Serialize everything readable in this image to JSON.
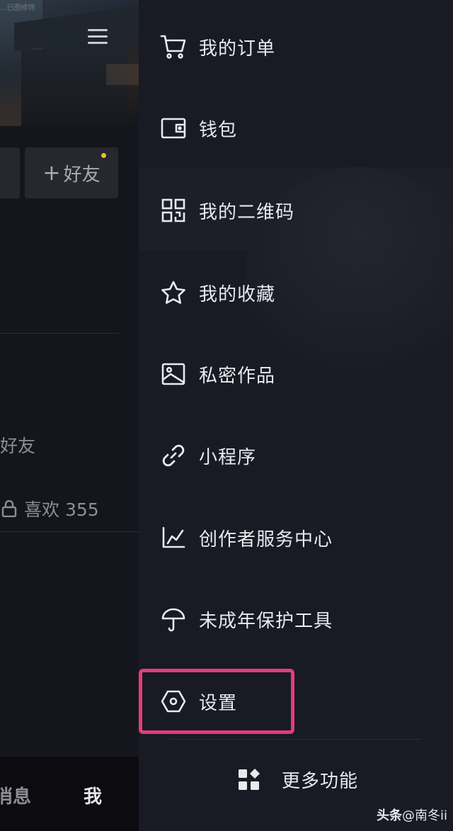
{
  "left_panel": {
    "banner_caption": "...已图修饰",
    "add_friend_label": "好友",
    "add_friend_plus": "+",
    "friends_text": "好友",
    "likes_label": "喜欢 355",
    "tab_messages": "消息",
    "tab_me": "我"
  },
  "drawer": {
    "items": [
      {
        "label": "我的订单",
        "icon": "shopping-cart-icon"
      },
      {
        "label": "钱包",
        "icon": "wallet-icon"
      },
      {
        "label": "我的二维码",
        "icon": "qr-code-icon"
      },
      {
        "label": "我的收藏",
        "icon": "star-icon"
      },
      {
        "label": "私密作品",
        "icon": "private-image-icon"
      },
      {
        "label": "小程序",
        "icon": "link-icon"
      },
      {
        "label": "创作者服务中心",
        "icon": "chart-line-icon"
      },
      {
        "label": "未成年保护工具",
        "icon": "umbrella-icon"
      },
      {
        "label": "设置",
        "icon": "settings-hexagon-icon"
      }
    ],
    "more_label": "更多功能",
    "more_icon": "grid-apps-icon"
  },
  "watermark": {
    "brand": "头条",
    "handle": "@南冬ii"
  },
  "colors": {
    "background": "#181a24",
    "highlight": "#e23c7c",
    "notification_dot": "#e8c32f",
    "text": "#e9e9ee"
  }
}
